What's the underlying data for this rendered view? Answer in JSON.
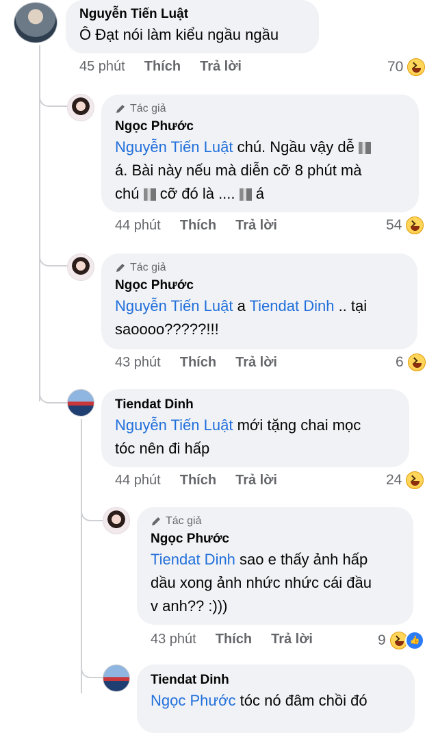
{
  "comments": [
    {
      "author": "Nguyễn Tiến Luật",
      "tag": "",
      "mention": "",
      "text": "Ô Đạt nói làm kiểu ngầu ngầu",
      "time": "45 phút",
      "like": "Thích",
      "reply": "Trả lời",
      "count": "70"
    },
    {
      "author": "Ngọc Phước",
      "tag": "Tác giả",
      "mention": "Nguyễn Tiến Luật",
      "text": " chú. Ngầu vậy dễ ",
      "text2": "á. Bài này nếu mà diễn cỡ 8 phút mà",
      "text3a": "chú ",
      "text3b": " cỡ đó là .... ",
      "text3c": " á",
      "time": "44 phút",
      "like": "Thích",
      "reply": "Trả lời",
      "count": "54"
    },
    {
      "author": "Ngọc Phước",
      "tag": "Tác giả",
      "mention": "Nguyễn Tiến Luật",
      "mid": " a ",
      "mention2": "Tiendat Dinh",
      "text": " .. tại",
      "text2": "saoooo?????!!!",
      "time": "43 phút",
      "like": "Thích",
      "reply": "Trả lời",
      "count": "6"
    },
    {
      "author": "Tiendat Dinh",
      "tag": "",
      "mention": "Nguyễn Tiến Luật",
      "text": " mới tặng chai mọc",
      "text2": "tóc nên đi hấp",
      "time": "44 phút",
      "like": "Thích",
      "reply": "Trả lời",
      "count": "24"
    },
    {
      "author": "Ngọc Phước",
      "tag": "Tác giả",
      "mention": "Tiendat Dinh",
      "text": " sao e thấy ảnh hấp",
      "text2": "dầu xong ảnh nhức nhức cái đầu",
      "text3": "v anh?? :)))",
      "time": "43 phút",
      "like": "Thích",
      "reply": "Trả lời",
      "count": "9"
    },
    {
      "author": "Tiendat Dinh",
      "tag": "",
      "mention": "Ngọc Phước",
      "text": " tóc nó đâm chồi đó"
    }
  ],
  "colors": {
    "mention": "#216fdb",
    "bubble": "#f0f2f5",
    "meta": "#65676b"
  }
}
